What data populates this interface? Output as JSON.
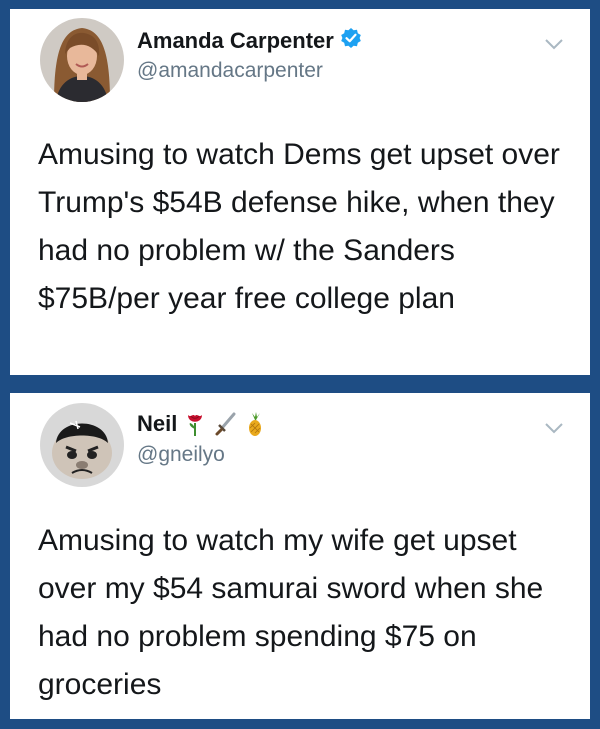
{
  "tweets": [
    {
      "author": {
        "name": "Amanda Carpenter",
        "handle": "@amandacarpenter",
        "verified": true
      },
      "text": "Amusing to watch Dems get upset over Trump's $54B defense hike, when they had no problem w/ the Sanders $75B/per year free college plan"
    },
    {
      "author": {
        "name": "Neil",
        "handle": "@gneilyo",
        "name_emojis": [
          "rose",
          "dagger",
          "pineapple"
        ]
      },
      "text": "Amusing to watch my wife get upset over my $54 samurai sword when she had no problem spending $75 on groceries"
    }
  ],
  "colors": {
    "background": "#1e4d84",
    "card": "#ffffff",
    "text": "#14171a",
    "handle": "#657786",
    "verified": "#1da1f2"
  }
}
